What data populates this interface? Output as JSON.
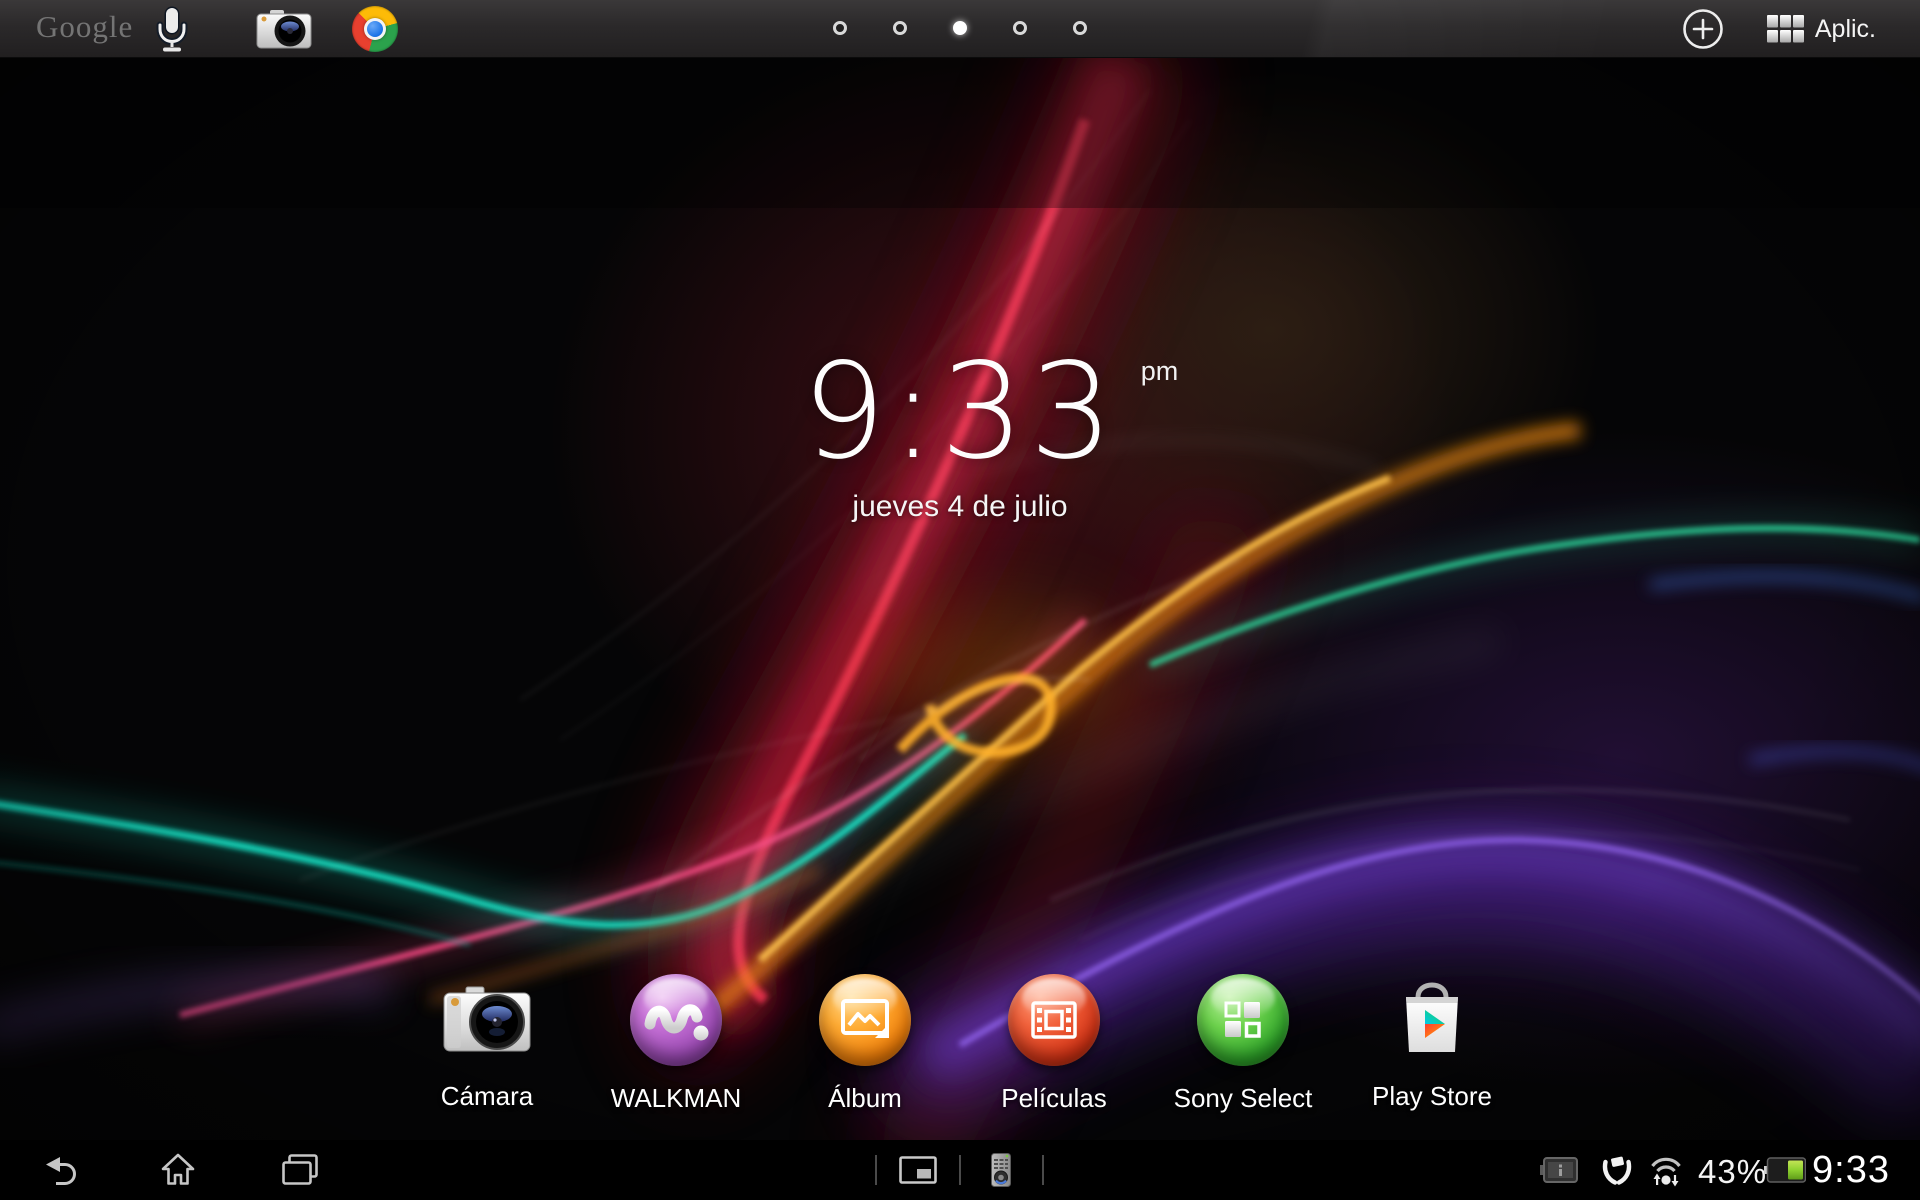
{
  "topbar": {
    "google_logo": "Google",
    "apps_label": "Aplic.",
    "page_dots": {
      "count": 5,
      "active_index": 2
    },
    "icons": {
      "voice-search-icon": "microphone",
      "camera-shortcut-icon": "compact camera",
      "chrome-icon": "chrome browser",
      "add-widget-icon": "plus in circle",
      "apps-grid-icon": "3x2 grid of squares"
    }
  },
  "clock_widget": {
    "time": "9:33",
    "meridiem": "pm",
    "date": "jueves 4 de julio"
  },
  "dock": {
    "apps": [
      {
        "label": "Cámara",
        "icon": "camera-app-icon"
      },
      {
        "label": "WALKMAN",
        "icon": "walkman-app-icon",
        "color": "#9d4cb5"
      },
      {
        "label": "Álbum",
        "icon": "album-app-icon",
        "color": "#f2800a"
      },
      {
        "label": "Películas",
        "icon": "movies-app-icon",
        "color": "#d63416"
      },
      {
        "label": "Sony Select",
        "icon": "sony-select-app-icon",
        "color": "#2fa52a"
      },
      {
        "label": "Play Store",
        "icon": "play-store-app-icon",
        "color": "#ffffff"
      }
    ]
  },
  "navbar": {
    "battery_percent": "43%",
    "clock": "9:33",
    "icons": {
      "back-icon": "return arrow",
      "home-icon": "house outline",
      "recents-icon": "stacked windows",
      "small-apps-icon": "window with inner panel",
      "remote-icon": "IR remote control",
      "notification-info-icon": "dimmed battery with i",
      "battery-care-icon": "hands holding battery",
      "wifi-activity-icon": "wifi arcs with up/down arrows",
      "battery-icon": "horizontal battery 43% green"
    },
    "colors": {
      "battery_green": "#8ed130",
      "icon_gray": "#c6c6c6"
    }
  },
  "wallpaper": {
    "name": "xperia-z-light-waves",
    "palette": [
      "#15dfc2",
      "#e93050",
      "#ff4b86",
      "#ffb02a",
      "#6f3fd0",
      "#9a6af8",
      "#ffffff"
    ]
  }
}
